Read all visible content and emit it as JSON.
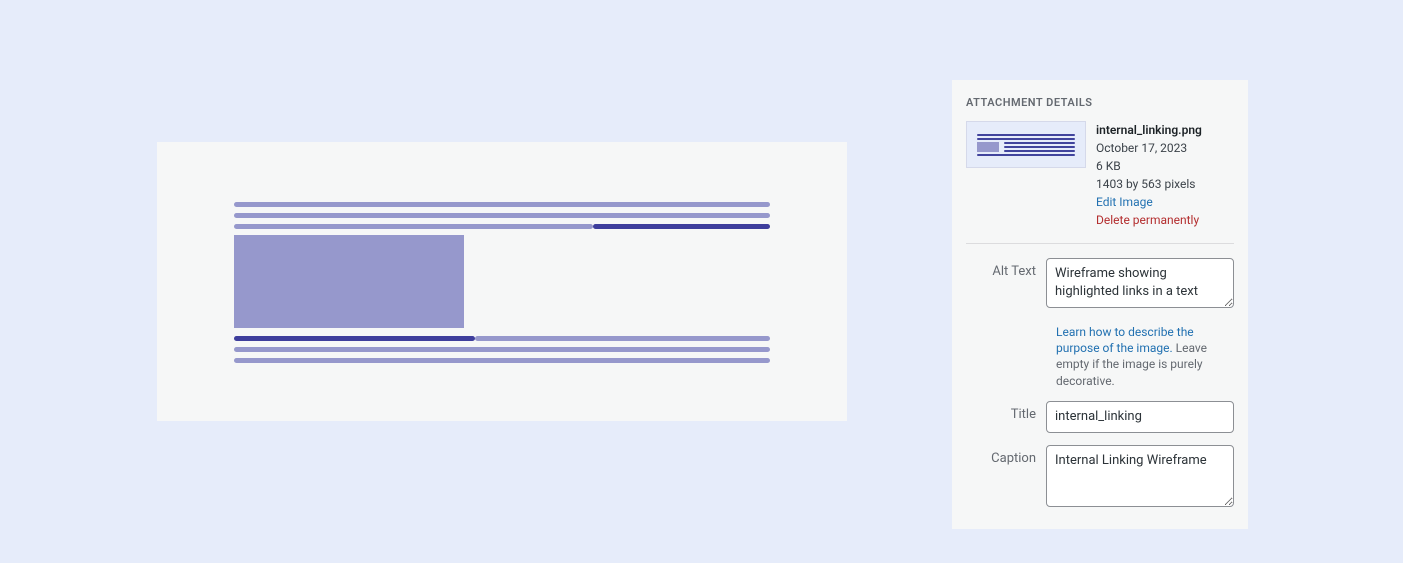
{
  "details_panel": {
    "heading": "ATTACHMENT DETAILS",
    "filename": "internal_linking.png",
    "date": "October 17, 2023",
    "filesize": "6 KB",
    "dimensions": "1403 by 563 pixels",
    "edit_link": "Edit Image",
    "delete_link": "Delete permanently",
    "fields": {
      "alt_text_label": "Alt Text",
      "alt_text_value": "Wireframe showing highlighted links in a text",
      "alt_help_link": "Learn how to describe the purpose of the image.",
      "alt_help_rest": " Leave empty if the image is purely decorative.",
      "title_label": "Title",
      "title_value": "internal_linking",
      "caption_label": "Caption",
      "caption_value": "Internal Linking Wireframe"
    }
  }
}
